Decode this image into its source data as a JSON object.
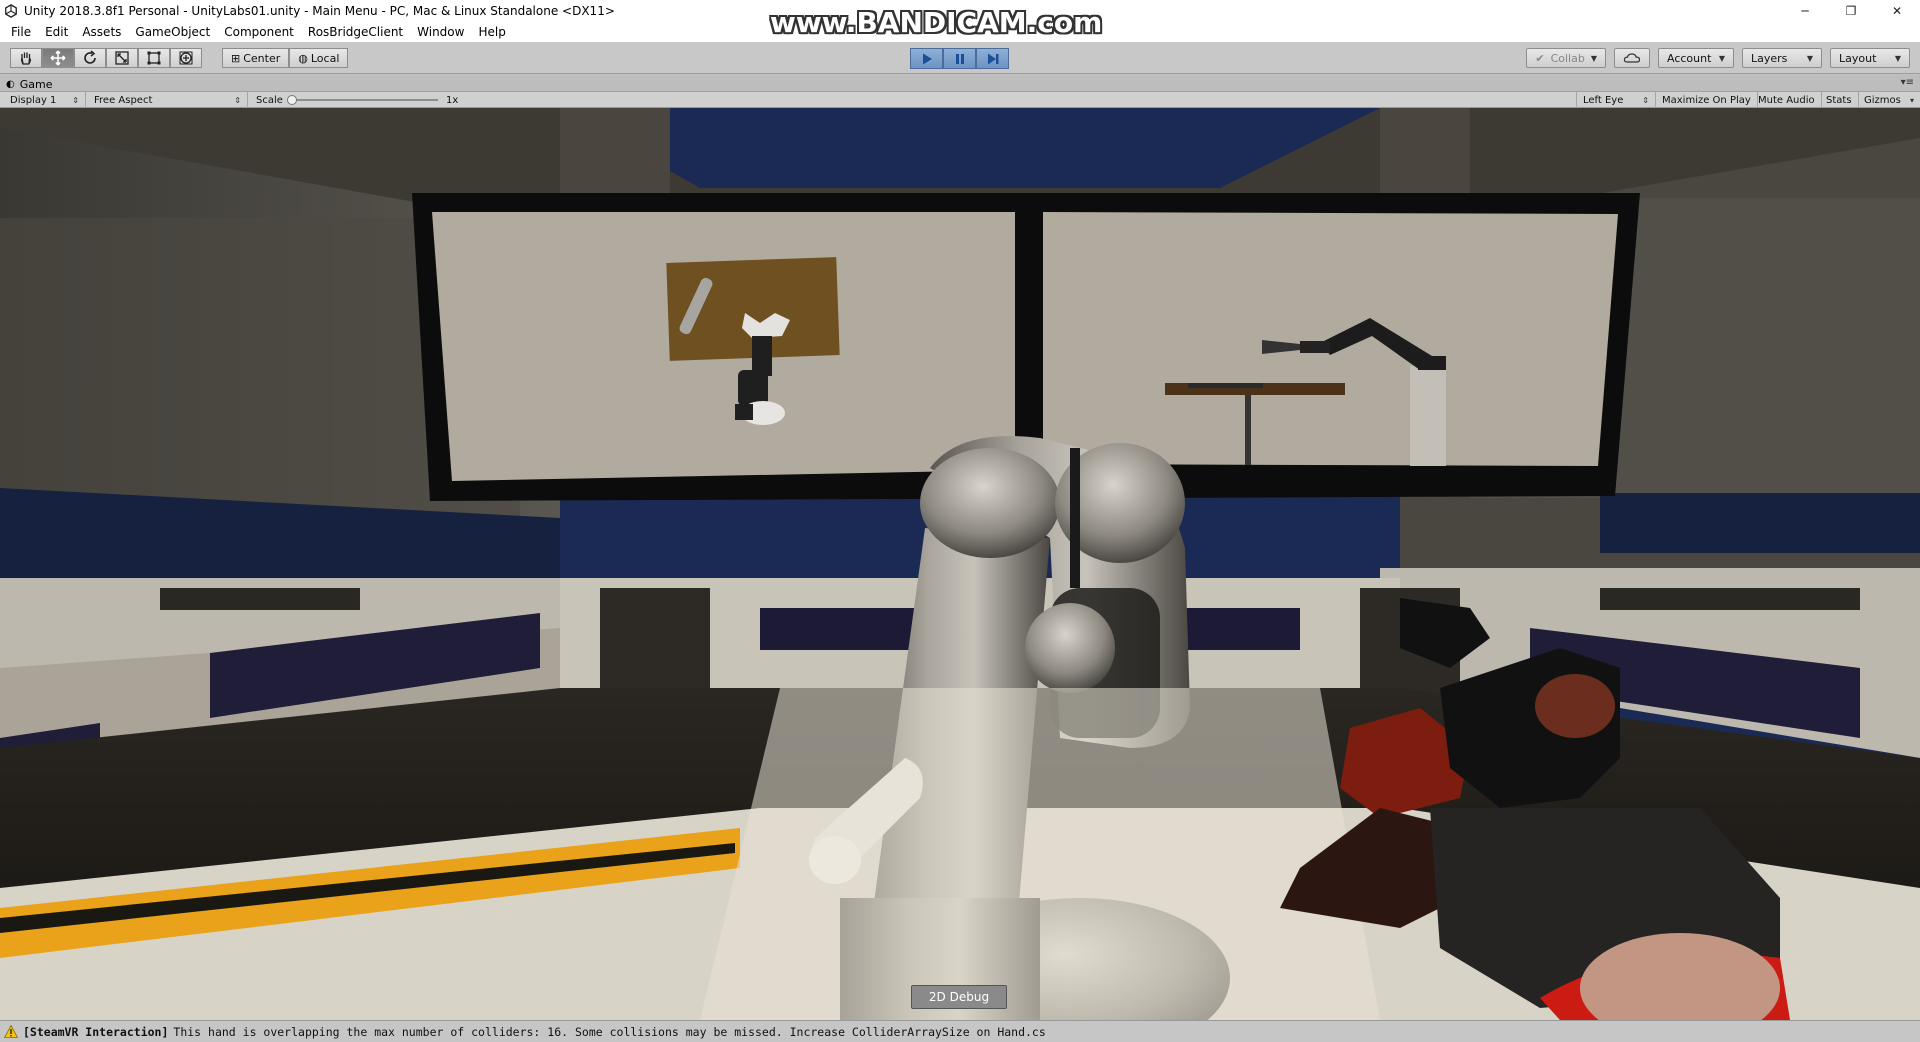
{
  "window": {
    "title": "Unity 2018.3.8f1 Personal - UnityLabs01.unity - Main Menu - PC, Mac & Linux Standalone <DX11>",
    "watermark": "www.BANDICAM.com",
    "controls": {
      "minimize": "─",
      "restore": "❐",
      "close": "✕"
    }
  },
  "menu": [
    "File",
    "Edit",
    "Assets",
    "GameObject",
    "Component",
    "RosBridgeClient",
    "Window",
    "Help"
  ],
  "toolbar": {
    "tools": [
      "hand-tool-icon",
      "move-tool-icon",
      "rotate-tool-icon",
      "scale-tool-icon",
      "rect-tool-icon",
      "transform-tool-icon"
    ],
    "pivot_mode": "Center",
    "pivot_rotation": "Local",
    "collab": "Collab",
    "account": "Account",
    "layers": "Layers",
    "layout": "Layout",
    "play_state": {
      "playing": true,
      "paused": true
    }
  },
  "game_tab": {
    "label": "Game"
  },
  "game_toolbar": {
    "display": "Display 1",
    "aspect": "Free Aspect",
    "scale_label": "Scale",
    "scale_value": "1x",
    "scale_fraction": 0.0,
    "eye": "Left Eye",
    "maximize": "Maximize On Play",
    "mute": "Mute Audio",
    "stats": "Stats",
    "gizmos": "Gizmos"
  },
  "viewport": {
    "debug_button": "2D Debug"
  },
  "status": {
    "tag": "[SteamVR Interaction]",
    "message": "This hand is overlapping the max number of colliders: 16. Some collisions may be missed. Increase ColliderArraySize on Hand.cs"
  }
}
